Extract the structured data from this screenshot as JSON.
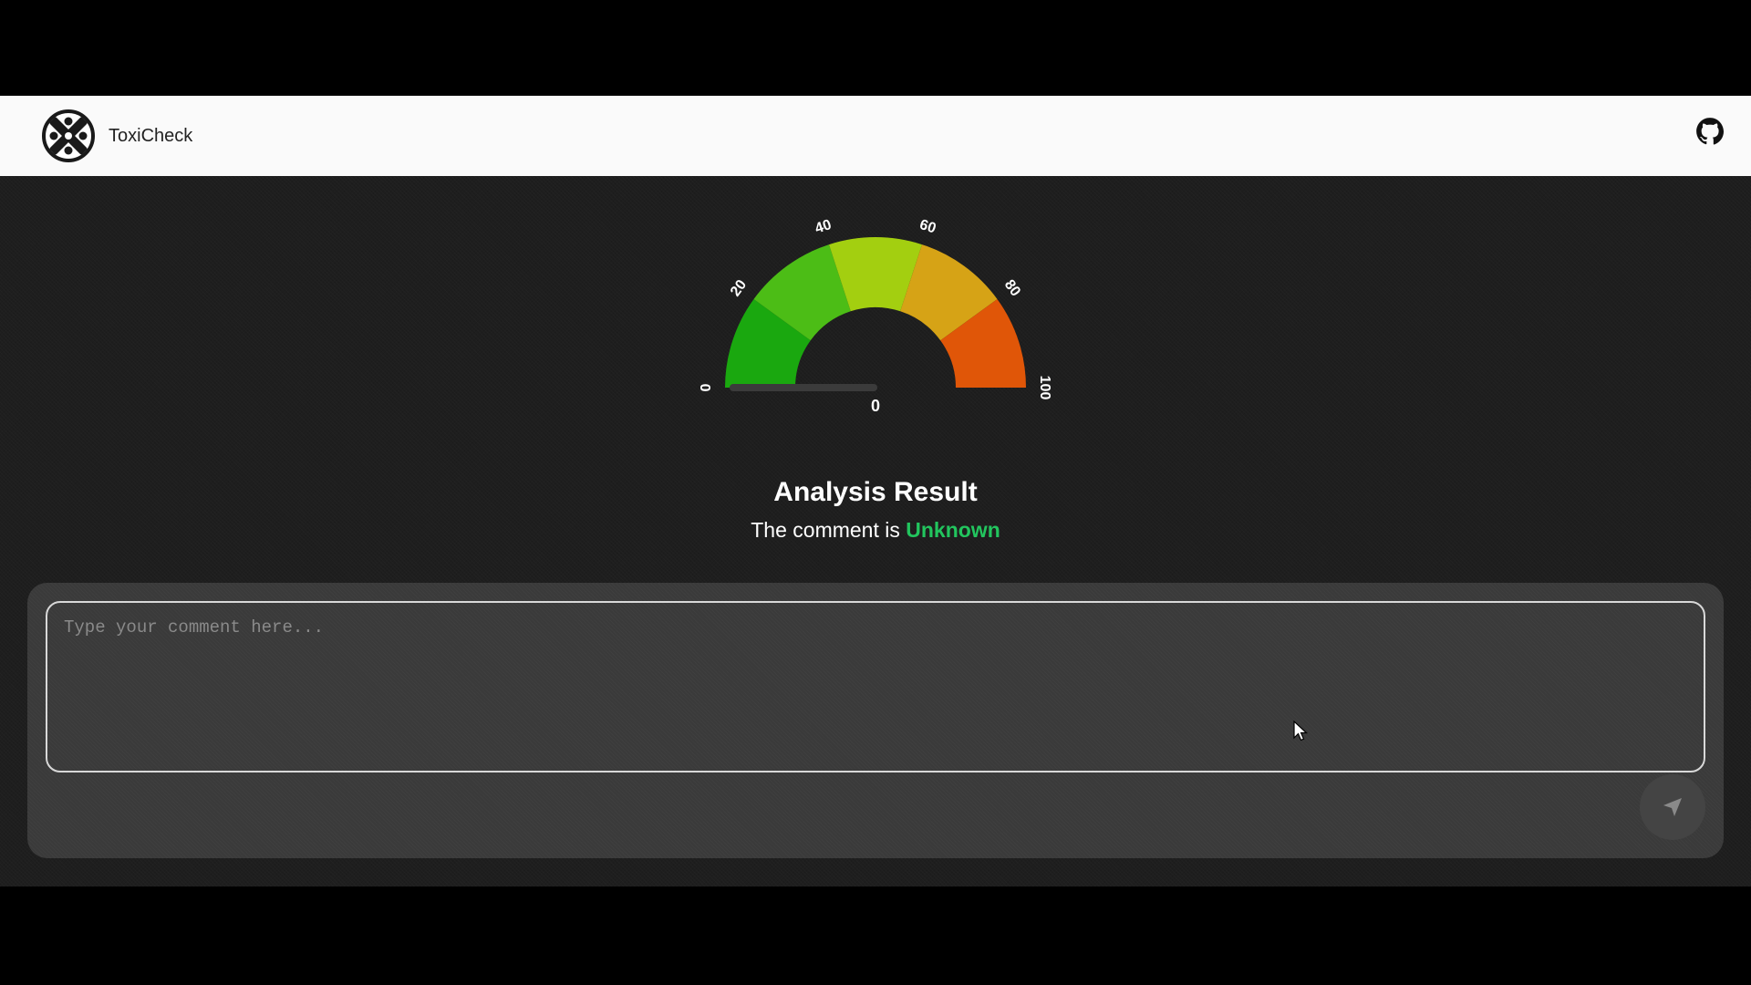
{
  "app": {
    "brand_name": "ToxiCheck",
    "logo_icon": "toxicheck-logo-icon",
    "github_icon": "github-icon"
  },
  "gauge": {
    "value": 0,
    "min": 0,
    "max": 100,
    "tick_labels": [
      "0",
      "20",
      "40",
      "60",
      "80",
      "100"
    ],
    "value_label": "0",
    "bands": [
      {
        "from": 0,
        "to": 20,
        "color": "#1aa80f"
      },
      {
        "from": 20,
        "to": 40,
        "color": "#4cbd16"
      },
      {
        "from": 40,
        "to": 60,
        "color": "#a3cf10"
      },
      {
        "from": 60,
        "to": 80,
        "color": "#d6a316"
      },
      {
        "from": 80,
        "to": 100,
        "color": "#e05608"
      }
    ]
  },
  "result": {
    "title": "Analysis Result",
    "prefix": "The comment is",
    "status": "Unknown",
    "status_color": "#22c55e"
  },
  "comment": {
    "placeholder": "Type your comment here...",
    "value": ""
  },
  "send": {
    "icon": "send-icon"
  }
}
